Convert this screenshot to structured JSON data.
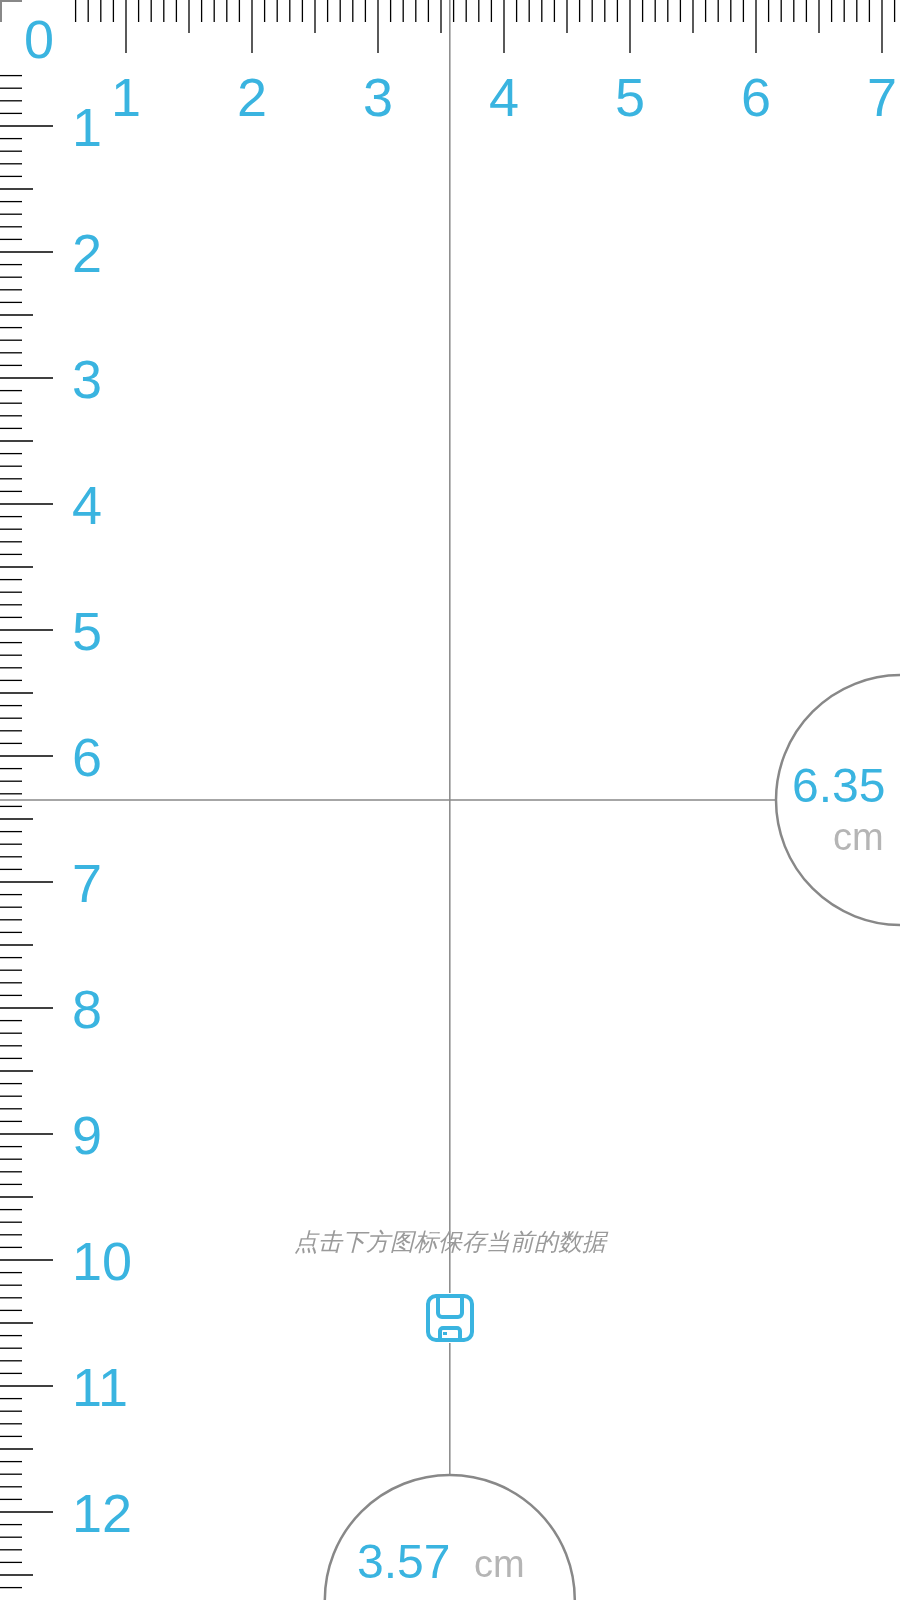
{
  "origin_label": "0",
  "horizontal_ruler": {
    "labels": [
      "1",
      "2",
      "3",
      "4",
      "5",
      "6",
      "7"
    ]
  },
  "vertical_ruler": {
    "labels": [
      "1",
      "2",
      "3",
      "4",
      "5",
      "6",
      "7",
      "8",
      "9",
      "10",
      "11",
      "12"
    ]
  },
  "hint": "点击下方图标保存当前的数据",
  "height_reading": {
    "value": "6.35",
    "unit": "cm"
  },
  "width_reading": {
    "value": "3.57",
    "unit": "cm"
  }
}
